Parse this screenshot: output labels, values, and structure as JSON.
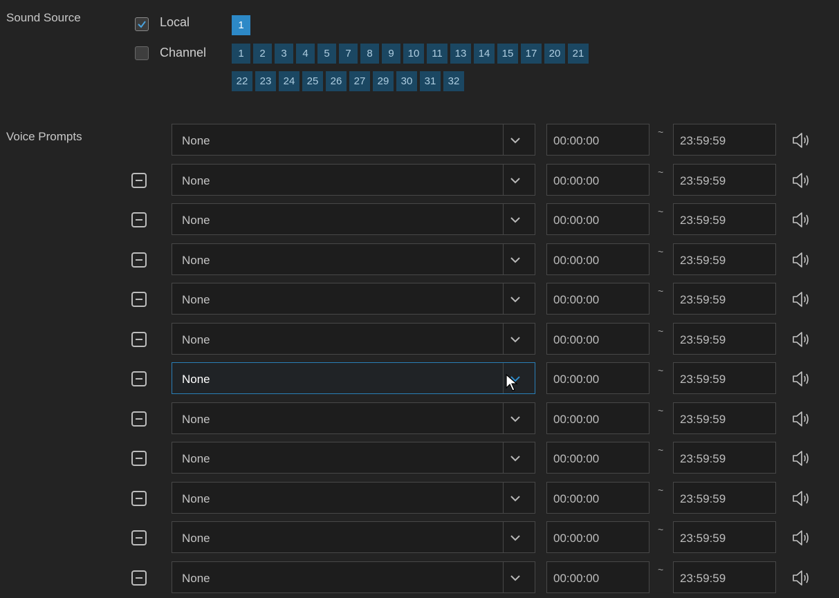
{
  "sound_source": {
    "label": "Sound Source",
    "local": {
      "label": "Local",
      "checked": true,
      "channels": [
        "1"
      ],
      "selected": "1"
    },
    "channel": {
      "label": "Channel",
      "checked": false,
      "row1": [
        "1",
        "2",
        "3",
        "4",
        "5",
        "7",
        "8",
        "9",
        "10",
        "11",
        "13",
        "14",
        "15",
        "17",
        "20",
        "21"
      ],
      "row2": [
        "22",
        "23",
        "24",
        "25",
        "26",
        "27",
        "29",
        "30",
        "31",
        "32"
      ]
    }
  },
  "voice_prompts": {
    "label": "Voice Prompts",
    "separator": "~",
    "rows": [
      {
        "prompt": "None",
        "start": "00:00:00",
        "end": "23:59:59",
        "removable": false,
        "focused": false
      },
      {
        "prompt": "None",
        "start": "00:00:00",
        "end": "23:59:59",
        "removable": true,
        "focused": false
      },
      {
        "prompt": "None",
        "start": "00:00:00",
        "end": "23:59:59",
        "removable": true,
        "focused": false
      },
      {
        "prompt": "None",
        "start": "00:00:00",
        "end": "23:59:59",
        "removable": true,
        "focused": false
      },
      {
        "prompt": "None",
        "start": "00:00:00",
        "end": "23:59:59",
        "removable": true,
        "focused": false
      },
      {
        "prompt": "None",
        "start": "00:00:00",
        "end": "23:59:59",
        "removable": true,
        "focused": false
      },
      {
        "prompt": "None",
        "start": "00:00:00",
        "end": "23:59:59",
        "removable": true,
        "focused": true
      },
      {
        "prompt": "None",
        "start": "00:00:00",
        "end": "23:59:59",
        "removable": true,
        "focused": false
      },
      {
        "prompt": "None",
        "start": "00:00:00",
        "end": "23:59:59",
        "removable": true,
        "focused": false
      },
      {
        "prompt": "None",
        "start": "00:00:00",
        "end": "23:59:59",
        "removable": true,
        "focused": false
      },
      {
        "prompt": "None",
        "start": "00:00:00",
        "end": "23:59:59",
        "removable": true,
        "focused": false
      },
      {
        "prompt": "None",
        "start": "00:00:00",
        "end": "23:59:59",
        "removable": true,
        "focused": false
      }
    ]
  },
  "colors": {
    "accent": "#2d89c7",
    "chip": "#1b4762",
    "background": "#232323"
  },
  "icons": {
    "remove": "minus-square-icon",
    "dropdown": "chevron-down-icon",
    "preview": "speaker-icon",
    "check": "checkmark-icon"
  }
}
